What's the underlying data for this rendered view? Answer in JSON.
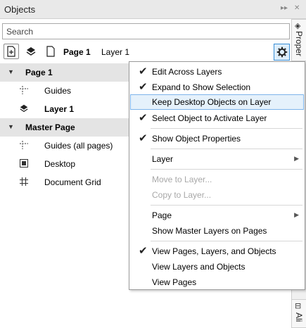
{
  "window": {
    "title": "Objects",
    "collapse_glyph": "▸▸",
    "close_glyph": "✕"
  },
  "search": {
    "placeholder": "Search",
    "value": ""
  },
  "toolbar": {
    "page_label": "Page 1",
    "layer_label": "Layer 1"
  },
  "tree": [
    {
      "label": "Page 1",
      "type": "page",
      "expanded": true
    },
    {
      "label": "Guides",
      "type": "guides"
    },
    {
      "label": "Layer 1",
      "type": "layer"
    },
    {
      "label": "Master Page",
      "type": "page",
      "expanded": true
    },
    {
      "label": "Guides (all pages)",
      "type": "guides"
    },
    {
      "label": "Desktop",
      "type": "desktop"
    },
    {
      "label": "Document Grid",
      "type": "grid"
    }
  ],
  "menu": {
    "items": [
      {
        "label": "Edit Across Layers",
        "checked": true,
        "enabled": true
      },
      {
        "label": "Expand to Show Selection",
        "checked": true,
        "enabled": true
      },
      {
        "label": "Keep Desktop Objects on Layer",
        "checked": false,
        "enabled": true,
        "highlighted": true
      },
      {
        "label": "Select Object to Activate Layer",
        "checked": true,
        "enabled": true
      },
      {
        "label": "Show Object Properties",
        "checked": true,
        "enabled": true
      },
      {
        "label": "Layer",
        "checked": false,
        "enabled": true,
        "submenu": true
      },
      {
        "label": "Move to Layer...",
        "checked": false,
        "enabled": false
      },
      {
        "label": "Copy to Layer...",
        "checked": false,
        "enabled": false
      },
      {
        "label": "Page",
        "checked": false,
        "enabled": true,
        "submenu": true
      },
      {
        "label": "Show Master Layers on Pages",
        "checked": false,
        "enabled": true
      },
      {
        "label": "View Pages, Layers, and Objects",
        "checked": true,
        "enabled": true
      },
      {
        "label": "View Layers and Objects",
        "checked": false,
        "enabled": true
      },
      {
        "label": "View Pages",
        "checked": false,
        "enabled": true
      }
    ]
  },
  "docker_tabs": [
    "Proper",
    "Ali"
  ],
  "colors": {
    "highlight_bg": "#e5f1fb",
    "highlight_border": "#7eb4ea",
    "header_row": "#e4e4e4"
  }
}
